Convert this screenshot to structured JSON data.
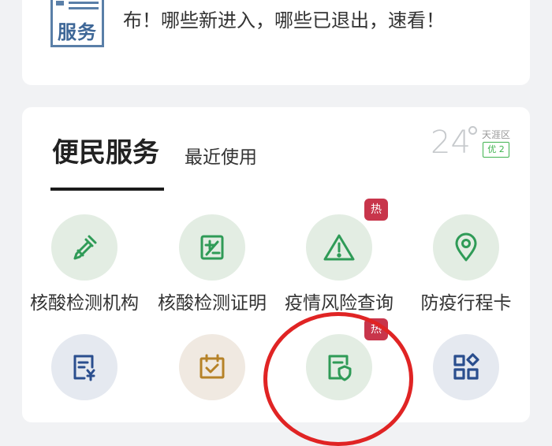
{
  "news": {
    "logo_text": "服务",
    "text": "布！哪些新进入，哪些已退出，速看！"
  },
  "services_panel": {
    "tab_active": "便民服务",
    "tab_recent": "最近使用",
    "weather": {
      "temperature": "24",
      "district": "天涯区",
      "aqi": "优 2"
    },
    "items": [
      {
        "label": "核酸检测机构",
        "icon": "dropper-icon",
        "hot": ""
      },
      {
        "label": "核酸检测证明",
        "icon": "certificate-icon",
        "hot": ""
      },
      {
        "label": "疫情风险查询",
        "icon": "warning-icon",
        "hot": "热"
      },
      {
        "label": "防疫行程卡",
        "icon": "location-pin-icon",
        "hot": ""
      },
      {
        "label": "",
        "icon": "invoice-icon",
        "hot": ""
      },
      {
        "label": "",
        "icon": "calendar-check-icon",
        "hot": ""
      },
      {
        "label": "",
        "icon": "shield-document-icon",
        "hot": "热"
      },
      {
        "label": "",
        "icon": "apps-grid-icon",
        "hot": ""
      }
    ]
  },
  "colors": {
    "icon_green": "#2f9b57",
    "icon_blue": "#2a4e8e",
    "icon_gold": "#b68228",
    "hot_badge": "#c8354b",
    "annotation_ring": "#e02424"
  }
}
